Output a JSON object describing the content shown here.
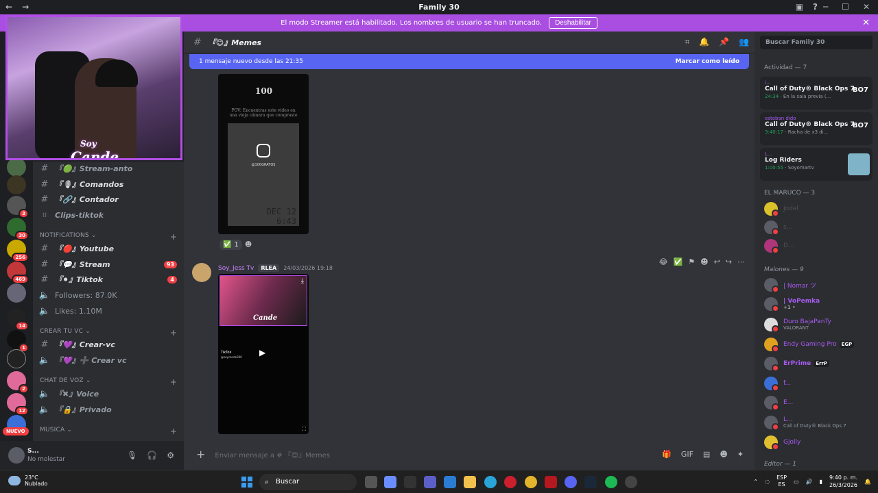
{
  "titlebar": {
    "title": "Family 30",
    "back": "←",
    "forward": "→",
    "icons": [
      "inbox-icon",
      "help-icon"
    ],
    "minimize": "─",
    "maximize": "☐",
    "close": "✕"
  },
  "banner": {
    "text": "El modo Streamer está habilitado. Los nombres de usuario se han truncado.",
    "button": "Deshabilitar",
    "close": "✕"
  },
  "webcam": {
    "logo_line1": "Soy",
    "logo_line2": "Cande"
  },
  "servers": [
    {
      "badge": "3"
    },
    {
      "badge": "30"
    },
    {
      "badge": "256"
    },
    {
      "badge": "469"
    },
    {
      "badge": "14"
    },
    {
      "badge": "1"
    },
    {
      "badge": "2"
    },
    {
      "badge": "12"
    }
  ],
  "nuevo_label": "NUEVO",
  "channels": {
    "top": [
      {
        "name": "『🟢』Stream-anto",
        "dim": true
      },
      {
        "name": "『🎙』Comandos"
      },
      {
        "name": "『🔗』Contador"
      },
      {
        "name": "Clips-tiktok",
        "dim": true
      }
    ],
    "notifications": {
      "label": "NOTIFICATIONS ⌄",
      "items": [
        {
          "name": "『🔴』Youtube"
        },
        {
          "name": "『💬』Stream",
          "count": "93"
        },
        {
          "name": "『⚫』Tiktok",
          "count": "4"
        }
      ],
      "voice": [
        {
          "name": "Followers: 87.0K"
        },
        {
          "name": "Likes: 1.10M"
        }
      ]
    },
    "crear_vc": {
      "label": "CREAR TU VC ⌄",
      "items": [
        {
          "name": "『💜』Crear-vc"
        },
        {
          "name": "『💜』➕ Crear vc",
          "voice": true
        }
      ]
    },
    "chat_voz": {
      "label": "CHAT DE VOZ ⌄",
      "items": [
        {
          "name": "『✖』Voice"
        },
        {
          "name": "『🔒』Privado"
        }
      ]
    },
    "musica": {
      "label": "MUSICA ⌄"
    }
  },
  "user": {
    "name": "S...",
    "status": "No molestar"
  },
  "chat": {
    "channel": "『😊』Memes",
    "newbar": "1 mensaje nuevo desde las 21:35",
    "mark_read": "Marcar como leído",
    "media1": {
      "caption": "POV: Encuentras este video en una vieja cámara que compraste",
      "handle": "@100GRATOS",
      "date": "DEC 12",
      "time": "6:43",
      "top": "100"
    },
    "reaction": {
      "emoji": "✅",
      "count": "1"
    },
    "message": {
      "author": "Soy_Jess Tv",
      "tag": "RLEA",
      "timestamp": "24/03/2026 19:18"
    },
    "media2": {
      "tiktok": "TikTok",
      "handle": "@soycande300",
      "overlay": "Cande"
    },
    "composer_placeholder": "Enviar mensaje a # 『😊』Memes"
  },
  "members": {
    "search": "Buscar Family 30",
    "activity_label": "Actividad — 7",
    "activities": [
      {
        "user": "i...",
        "game": "Call of Duty® Black Ops 7",
        "time": "24:34",
        "detail": "En la sala previa (...",
        "badge": "BO7"
      },
      {
        "user": "esteban dido",
        "game": "Call of Duty® Black Ops 7",
        "time": "3:40:17",
        "detail": "Racha de x3 di...",
        "badge": "BO7"
      },
      {
        "user": "L...",
        "game": "Log Riders",
        "time": "1:00:55",
        "detail": "Soyomartv"
      }
    ],
    "group1_label": "EL MARUCO — 3",
    "group1": [
      {
        "name": "Jodel"
      },
      {
        "name": "s..."
      },
      {
        "name": "D..."
      }
    ],
    "group2_label": "Malones — 9",
    "group2": [
      {
        "name": "| Nomar ツ"
      },
      {
        "name": "| VoPemka",
        "sub": "+1 •"
      },
      {
        "name": "Duro BajaPanTy",
        "sub": "VALORANT"
      },
      {
        "name": "Endy Gaming Pro",
        "tag": "EGP"
      },
      {
        "name": "ErPrime",
        "tag": "ErrP"
      },
      {
        "name": "f..."
      },
      {
        "name": "E..."
      },
      {
        "name": "L...",
        "sub": "Call of Duty® Black Ops 7"
      },
      {
        "name": "Gjolly"
      }
    ],
    "group3_label": "Editor — 1"
  },
  "taskbar": {
    "weather_temp": "23°C",
    "weather_desc": "Nublado",
    "search": "Buscar",
    "lang": "ESP",
    "lang2": "ES",
    "time": "9:40 p. m.",
    "date": "26/3/2026"
  },
  "colors": {
    "accent": "#5865f2",
    "streamer": "#a94ee0",
    "role_purple": "#a75bf0"
  }
}
